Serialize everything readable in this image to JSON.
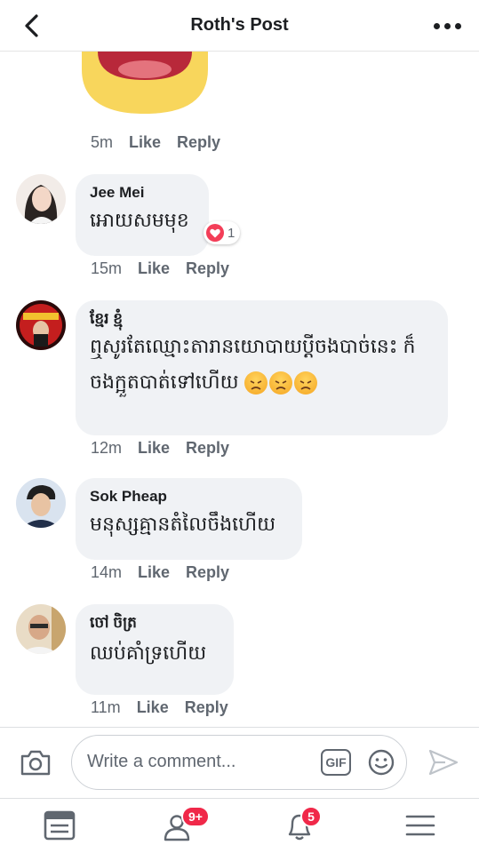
{
  "header": {
    "title": "Roth's Post"
  },
  "top_comment": {
    "time": "5m",
    "like": "Like",
    "reply": "Reply"
  },
  "comments": [
    {
      "name": "Jee Mei",
      "text": "អោយសមមុខ",
      "time": "15m",
      "like": "Like",
      "reply": "Reply",
      "reaction_count": "1"
    },
    {
      "name": "ខ្មែរ ខ្មុំ",
      "text_line1": "ឮសូរតែឈ្មោះតារានយោបាយប្តីចងបាច់នេះ ក៏",
      "text_line2": "ចងក្អួតបាត់ទៅហើយ",
      "emojis": [
        "angry-emoji",
        "angry-emoji",
        "angry-emoji"
      ],
      "time": "12m",
      "like": "Like",
      "reply": "Reply"
    },
    {
      "name": "Sok Pheap",
      "text": "មនុស្សគ្មានតំលៃចឹងហើយ",
      "time": "14m",
      "like": "Like",
      "reply": "Reply"
    },
    {
      "name": "ចៅ ចិត្រ",
      "text": "ឈប់គាំទ្រហើយ",
      "time": "11m",
      "like": "Like",
      "reply": "Reply"
    }
  ],
  "composer": {
    "placeholder": "Write a comment...",
    "gif_label": "GIF"
  },
  "nav": {
    "friends_badge": "9+",
    "notifications_badge": "5"
  },
  "colors": {
    "badge": "#f02849",
    "bubble": "#f0f2f5",
    "meta": "#606770",
    "heart": "#f33e58"
  }
}
